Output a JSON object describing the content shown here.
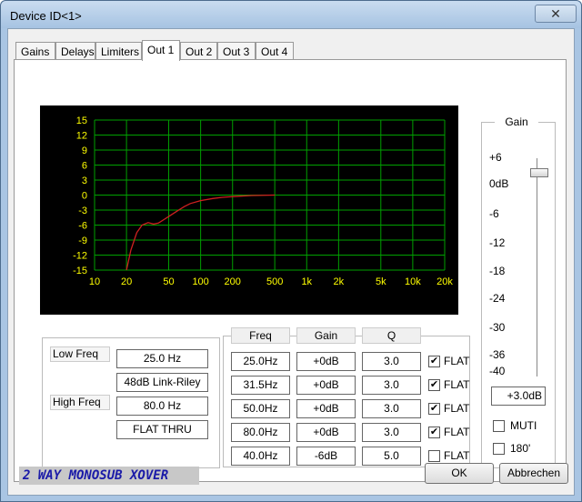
{
  "window": {
    "title": "Device ID<1>",
    "close_label": "✕"
  },
  "tabs": [
    {
      "label": "Gains",
      "active": false
    },
    {
      "label": "Delays",
      "active": false
    },
    {
      "label": "Limiters",
      "active": false
    },
    {
      "label": "Out 1",
      "active": true
    },
    {
      "label": "Out 2",
      "active": false
    },
    {
      "label": "Out 3",
      "active": false
    },
    {
      "label": "Out 4",
      "active": false
    }
  ],
  "chart_data": {
    "type": "line",
    "y_ticks": [
      "15",
      "12",
      "9",
      "6",
      "3",
      "0",
      "-3",
      "-6",
      "-9",
      "-12",
      "-15"
    ],
    "x_ticks": [
      "10",
      "20",
      "50",
      "100",
      "200",
      "500",
      "1k",
      "2k",
      "5k",
      "10k",
      "20k"
    ],
    "ylim": [
      -15,
      15
    ],
    "xlim": [
      10,
      20000
    ],
    "x_scale": "log",
    "grid": true,
    "series": [
      {
        "color": "#d02020",
        "x": [
          20,
          22,
          25,
          28,
          32,
          36,
          40,
          45,
          50,
          60,
          70,
          80,
          100,
          130,
          160,
          200,
          300,
          500
        ],
        "y": [
          -15,
          -11,
          -7.5,
          -6,
          -5.5,
          -5.8,
          -5.6,
          -4.9,
          -4.3,
          -3.2,
          -2.3,
          -1.7,
          -1.1,
          -0.7,
          -0.45,
          -0.3,
          -0.1,
          0
        ]
      }
    ],
    "colors": {
      "background": "#000000",
      "grid": "#00a000",
      "ticks": "#ffff00",
      "curve": "#d02020"
    }
  },
  "crossover": {
    "low_freq_label": "Low Freq",
    "low_freq_value": "25.0 Hz",
    "low_filter": "48dB Link-Riley",
    "high_freq_label": "High Freq",
    "high_freq_value": "80.0 Hz",
    "high_filter": "FLAT THRU"
  },
  "eq": {
    "headers": {
      "freq": "Freq",
      "gain": "Gain",
      "q": "Q"
    },
    "bands": [
      {
        "freq": "25.0Hz",
        "gain": "+0dB",
        "q": "3.0",
        "flat": "FLAT",
        "checked": true
      },
      {
        "freq": "31.5Hz",
        "gain": "+0dB",
        "q": "3.0",
        "flat": "FLAT",
        "checked": true
      },
      {
        "freq": "50.0Hz",
        "gain": "+0dB",
        "q": "3.0",
        "flat": "FLAT",
        "checked": true
      },
      {
        "freq": "80.0Hz",
        "gain": "+0dB",
        "q": "3.0",
        "flat": "FLAT",
        "checked": true
      },
      {
        "freq": "40.0Hz",
        "gain": "-6dB",
        "q": "5.0",
        "flat": "FLAT",
        "checked": false
      }
    ]
  },
  "gain_panel": {
    "title": "Gain",
    "scale": [
      "+6",
      "0dB",
      "-6",
      "-12",
      "-18",
      "-24",
      "-30",
      "-36",
      "-40"
    ],
    "value": "+3.0dB",
    "level_db": 3.0,
    "muti_label": "MUTI",
    "phase_label": "180'"
  },
  "footer": {
    "banner": "2 WAY MONOSUB XOVER",
    "ok_label": "OK",
    "cancel_label": "Abbrechen"
  }
}
